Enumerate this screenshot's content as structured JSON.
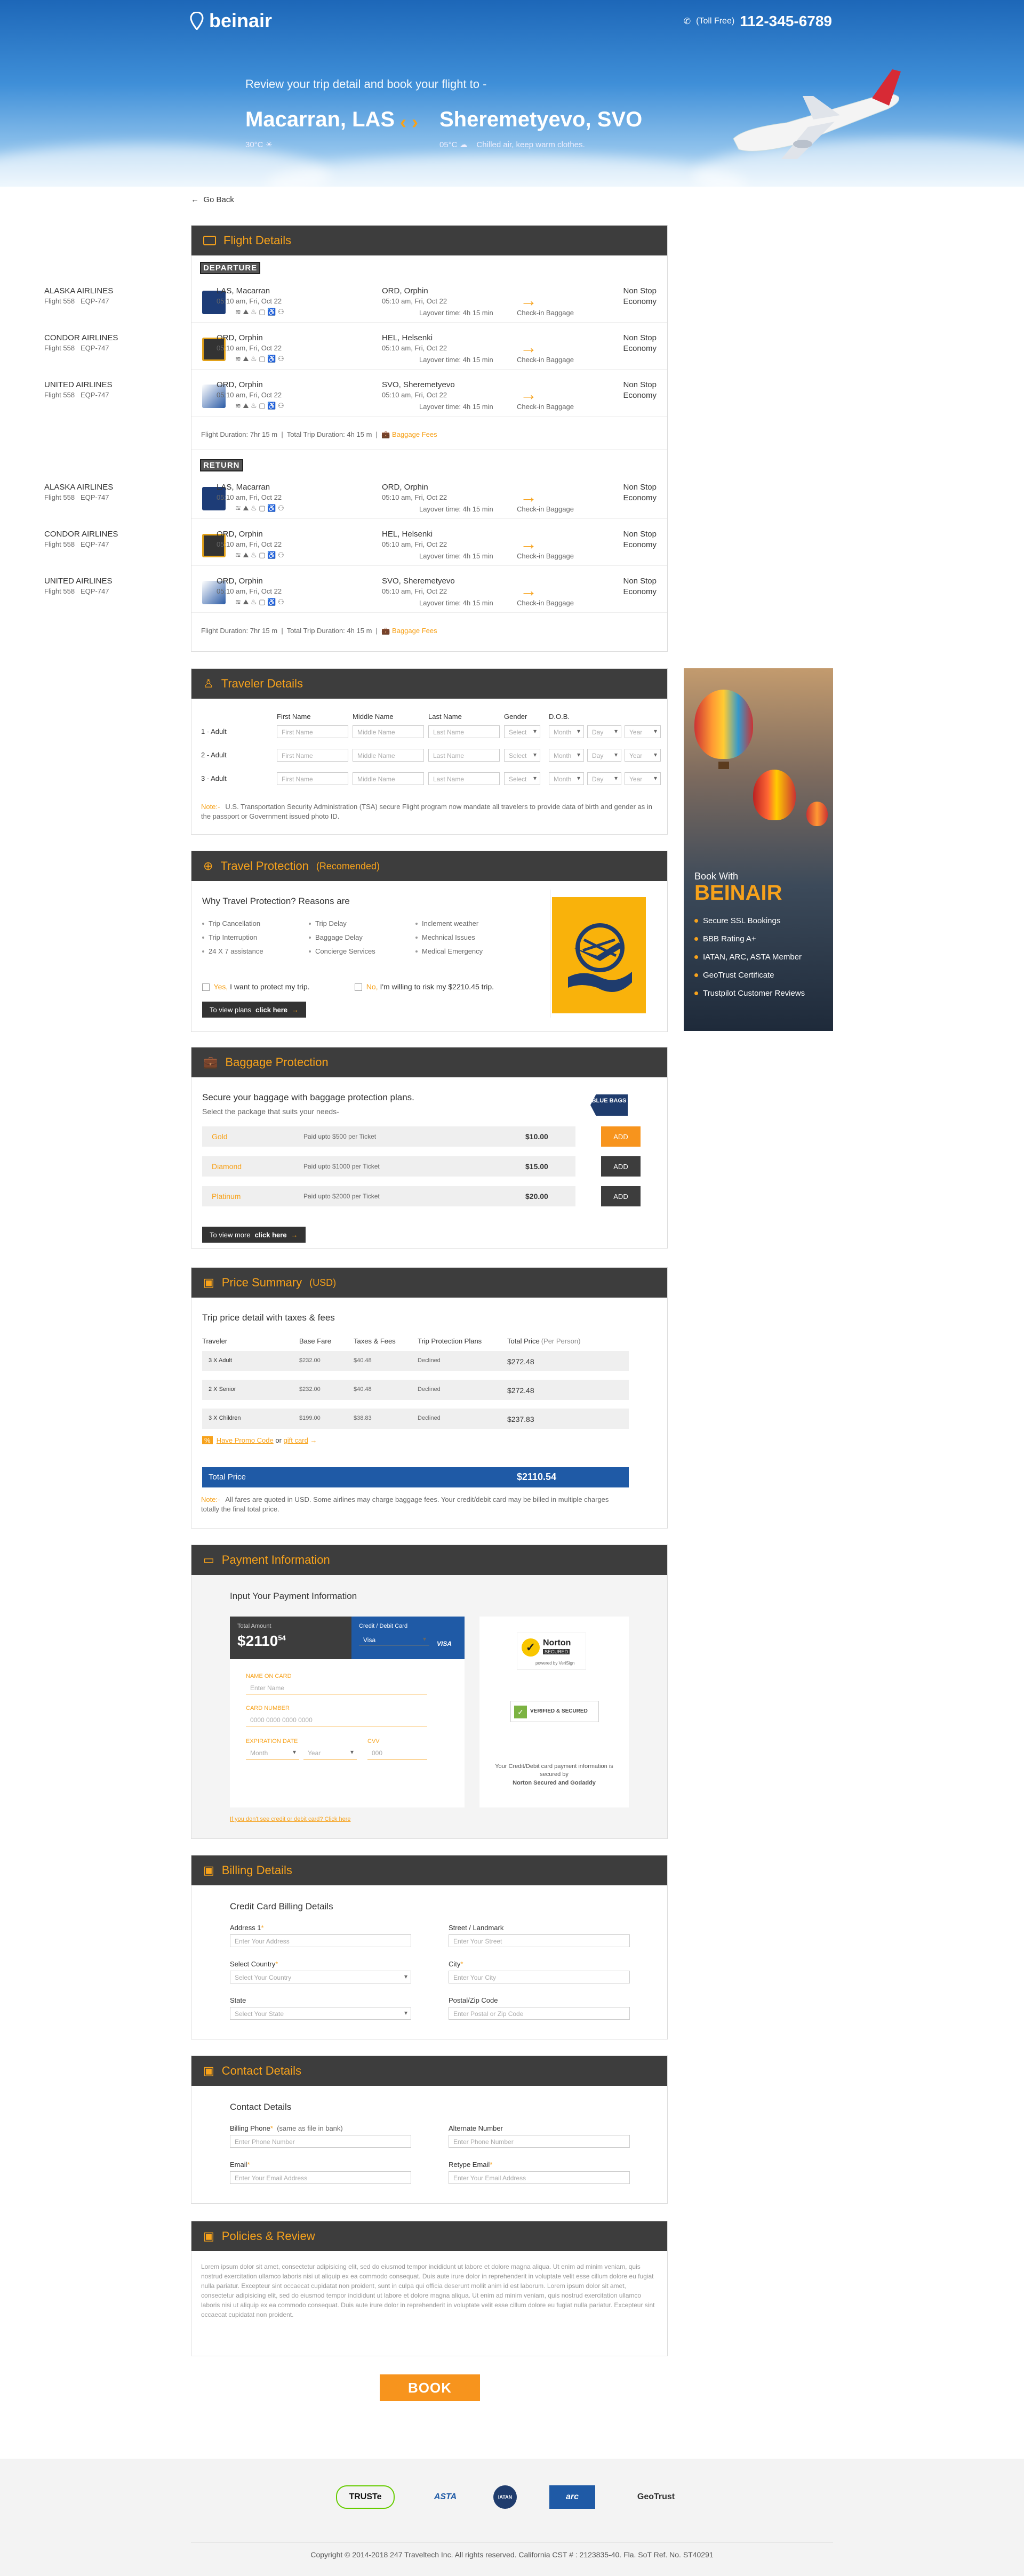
{
  "header": {
    "brand": "beinair",
    "toll_free": "(Toll Free)",
    "phone": "112-345-6789",
    "subtitle": "Review your trip detail and book your flight to -",
    "from_city": "Macarran, LAS",
    "from_weather": "30°C",
    "to_city": "Sheremetyevo, SVO",
    "to_weather": "05°C",
    "to_note": "Chilled air, keep warm clothes."
  },
  "back_label": "Go Back",
  "flight_details": {
    "title": "Flight Details",
    "departure_label": "DEPARTURE",
    "return_label": "RETURN",
    "departure": [
      {
        "airline": "ALASKA AIRLINES",
        "flight": "Flight 558",
        "aircraft": "EQP-747",
        "from": "LAS, Macarran",
        "from_time": "05:10 am, Fri, Oct 22",
        "to": "ORD, Orphin",
        "to_time": "05:10 am, Fri, Oct 22",
        "stops": "Non Stop",
        "cabin": "Economy",
        "layover": "Layover time: 4h 15 min",
        "baggage": "Check-in Baggage"
      },
      {
        "airline": "CONDOR AIRLINES",
        "flight": "Flight 558",
        "aircraft": "EQP-747",
        "from": "ORD, Orphin",
        "from_time": "05:10 am, Fri, Oct 22",
        "to": "HEL, Helsenki",
        "to_time": "05:10 am, Fri, Oct 22",
        "stops": "Non Stop",
        "cabin": "Economy",
        "layover": "Layover time: 4h 15 min",
        "baggage": "Check-in Baggage"
      },
      {
        "airline": "UNITED AIRLINES",
        "flight": "Flight 558",
        "aircraft": "EQP-747",
        "from": "ORD, Orphin",
        "from_time": "05:10 am, Fri, Oct 22",
        "to": "SVO, Sheremetyevo",
        "to_time": "05:10 am, Fri, Oct 22",
        "stops": "Non Stop",
        "cabin": "Economy",
        "layover": "Layover time: 4h 15 min",
        "baggage": "Check-in Baggage"
      }
    ],
    "return": [
      {
        "airline": "ALASKA AIRLINES",
        "flight": "Flight 558",
        "aircraft": "EQP-747",
        "from": "LAS, Macarran",
        "from_time": "05:10 am, Fri, Oct 22",
        "to": "ORD, Orphin",
        "to_time": "05:10 am, Fri, Oct 22",
        "stops": "Non Stop",
        "cabin": "Economy",
        "layover": "Layover time: 4h 15 min",
        "baggage": "Check-in Baggage"
      },
      {
        "airline": "CONDOR AIRLINES",
        "flight": "Flight 558",
        "aircraft": "EQP-747",
        "from": "ORD, Orphin",
        "from_time": "05:10 am, Fri, Oct 22",
        "to": "HEL, Helsenki",
        "to_time": "05:10 am, Fri, Oct 22",
        "stops": "Non Stop",
        "cabin": "Economy",
        "layover": "Layover time: 4h 15 min",
        "baggage": "Check-in Baggage"
      },
      {
        "airline": "UNITED AIRLINES",
        "flight": "Flight 558",
        "aircraft": "EQP-747",
        "from": "ORD, Orphin",
        "from_time": "05:10 am, Fri, Oct 22",
        "to": "SVO, Sheremetyevo",
        "to_time": "05:10 am, Fri, Oct 22",
        "stops": "Non Stop",
        "cabin": "Economy",
        "layover": "Layover time: 4h 15 min",
        "baggage": "Check-in Baggage"
      }
    ],
    "flight_duration_label": "Flight Duration:",
    "flight_duration": "7hr 15 m",
    "total_duration_label": "Total Trip Duration:",
    "total_duration": "4h 15 m",
    "baggage_fees": "Baggage Fees"
  },
  "traveler": {
    "title": "Traveler Details",
    "columns": [
      "First Name",
      "Middle Name",
      "Last Name",
      "Gender",
      "D.O.B."
    ],
    "rows": [
      "1 - Adult",
      "2 - Adult",
      "3 - Adult"
    ],
    "placeholders": {
      "first": "First Name",
      "middle": "Middle Name",
      "last": "Last Name",
      "gender": "Select",
      "month": "Month",
      "day": "Day",
      "year": "Year"
    },
    "note_label": "Note:-",
    "note": "U.S. Transportation Security Administration (TSA) secure Flight program now mandate all travelers to provide data of birth and gender as in the passport or Government issued photo ID."
  },
  "banner": {
    "line1": "Book With",
    "line2": "BEINAIR",
    "items": [
      "Secure SSL Bookings",
      "BBB Rating A+",
      "IATAN, ARC, ASTA Member",
      "GeoTrust Certificate",
      "Trustpilot Customer Reviews"
    ]
  },
  "protection": {
    "title": "Travel Protection",
    "title_tag": "(Recomended)",
    "heading": "Why Travel Protection? Reasons are",
    "reasons": [
      "Trip Cancellation",
      "Trip Interruption",
      "24 X 7 assistance",
      "Trip Delay",
      "Baggage Delay",
      "Concierge Services",
      "Inclement weather",
      "Mechnical Issues",
      "Medical Emergency"
    ],
    "yes_word": "Yes,",
    "yes_text": "I want to protect my trip.",
    "no_word": "No,",
    "no_text": "I'm willing to risk my $2210.45 trip.",
    "plans_button": "To view plans",
    "plans_link": "click here"
  },
  "baggage": {
    "title": "Baggage Protection",
    "heading": "Secure your baggage with baggage protection plans.",
    "subheading": "Select the package that suits your needs-",
    "tag": "BLUE BAGS",
    "plans": [
      {
        "name": "Gold",
        "desc": "Paid upto $500 per Ticket",
        "price": "$10.00",
        "action": "ADD",
        "color": "#f7941d"
      },
      {
        "name": "Diamond",
        "desc": "Paid upto $1000 per Ticket",
        "price": "$15.00",
        "action": "ADD",
        "color": "#3d3d3d"
      },
      {
        "name": "Platinum",
        "desc": "Paid upto $2000 per Ticket",
        "price": "$20.00",
        "action": "ADD",
        "color": "#3d3d3d"
      }
    ],
    "more_button": "To view more",
    "more_link": "click here"
  },
  "price": {
    "title": "Price Summary",
    "currency": "(USD)",
    "heading": "Trip price detail with taxes & fees",
    "columns": [
      "Traveler",
      "Base Fare",
      "Taxes & Fees",
      "Trip Protection Plans",
      "Total Price"
    ],
    "total_note": "(Per Person)",
    "rows": [
      {
        "traveler": "3 X Adult",
        "base": "$232.00",
        "tax": "$40.48",
        "plan": "Declined",
        "total": "$272.48"
      },
      {
        "traveler": "2 X Senior",
        "base": "$232.00",
        "tax": "$40.48",
        "plan": "Declined",
        "total": "$272.48"
      },
      {
        "traveler": "3 X Children",
        "base": "$199.00",
        "tax": "$38.83",
        "plan": "Declined",
        "total": "$237.83"
      }
    ],
    "promo_prefix": "Have Promo Code",
    "promo_or": "or",
    "promo_gift": "gift card",
    "total_label": "Total Price",
    "total_value": "$2110.54",
    "note_label": "Note:-",
    "note": "All fares are quoted in USD. Some airlines may charge baggage fees. Your credit/debit card may be billed in multiple charges totally the final total price."
  },
  "payment": {
    "title": "Payment Information",
    "heading": "Input Your Payment Information",
    "total_amount_label": "Total Amount",
    "total_amount": "$2110",
    "total_amount_cents": "54",
    "card_type_label": "Credit / Debit Card",
    "card_type_value": "Visa",
    "card_brand": "VISA",
    "name_label": "NAME ON CARD",
    "name_placeholder": "Enter Name",
    "number_label": "CARD NUMBER",
    "number_placeholder": "0000 0000 0000 0000",
    "expiry_label": "EXPIRATION DATE",
    "expiry_month": "Month",
    "expiry_year": "Year",
    "cvv_label": "CVV",
    "cvv_placeholder": "000",
    "norton": "Norton",
    "norton_secured": "SECURED",
    "norton_by": "powered by VeriSign",
    "verified": "VERIFIED & SECURED",
    "secure_note": "Your Credit/Debit card payment information is secured by",
    "secure_brands": "Norton Secured and Godaddy",
    "no_card_link": "If you don't see credit or debit card? Click here"
  },
  "billing": {
    "title": "Billing Details",
    "heading": "Credit Card Billing Details",
    "address_label": "Address 1",
    "address_placeholder": "Enter Your Address",
    "street_label": "Street / Landmark",
    "street_placeholder": "Enter Your Street",
    "country_label": "Select Country",
    "country_placeholder": "Select Your Country",
    "city_label": "City",
    "city_placeholder": "Enter Your City",
    "state_label": "State",
    "state_placeholder": "Select Your State",
    "zip_label": "Postal/Zip Code",
    "zip_placeholder": "Enter Postal or Zip Code"
  },
  "contact": {
    "title": "Contact Details",
    "heading": "Contact Details",
    "billing_phone_label": "Billing Phone",
    "billing_phone_note": "(same as file in bank)",
    "billing_phone_placeholder": "Enter Phone Number",
    "alt_label": "Alternate Number",
    "alt_placeholder": "Enter Phone Number",
    "email_label": "Email",
    "email_placeholder": "Enter Your Email Address",
    "retype_label": "Retype Email",
    "retype_placeholder": "Enter Your Email Address"
  },
  "policies": {
    "title": "Policies & Review",
    "text": "Lorem ipsum dolor sit amet, consectetur adipisicing elit, sed do eiusmod tempor incididunt ut labore et dolore magna aliqua. Ut enim ad minim veniam, quis nostrud exercitation ullamco laboris nisi ut aliquip ex ea commodo consequat. Duis aute irure dolor in reprehenderit in voluptate velit esse cillum dolore eu fugiat nulla pariatur. Excepteur sint occaecat cupidatat non proident, sunt in culpa qui officia deserunt mollit anim id est laborum. Lorem ipsum dolor sit amet, consectetur adipisicing elit, sed do eiusmod tempor incididunt ut labore et dolore magna aliqua. Ut enim ad minim veniam, quis nostrud exercitation ullamco laboris nisi ut aliquip ex ea commodo consequat. Duis aute irure dolor in reprehenderit in voluptate velit esse cillum dolore eu fugiat nulla pariatur. Excepteur sint occaecat cupidatat non proident."
  },
  "book_button": "BOOK",
  "footer": {
    "logos": [
      "TRUSTe",
      "ASTA",
      "IATAN",
      "arc",
      "GeoTrust"
    ],
    "copyright": "Copyright © 2014-2018 247 Traveltech Inc. All rights reserved. California CST # : 2123835-40. Fla. SoT Ref. No. ST40291"
  },
  "colors": {
    "accent": "#f7941d",
    "header_dark": "#3d3d3d",
    "total_blue": "#1f5aa6"
  }
}
